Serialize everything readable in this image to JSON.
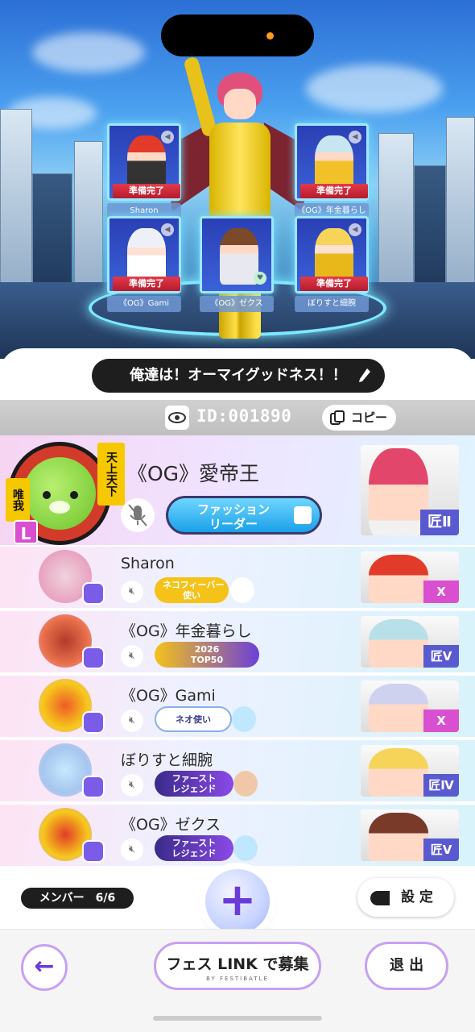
{
  "scene": {
    "party": [
      {
        "name": "Sharon",
        "status": "準備完了"
      },
      {
        "name": "《OG》年金暮らし",
        "status": "準備完了"
      },
      {
        "name": "《OG》Gami",
        "status": "準備完了"
      },
      {
        "name": "《OG》ゼクス",
        "status": ""
      },
      {
        "name": "ぼりすと細腕",
        "status": "準備完了"
      }
    ]
  },
  "team": {
    "name": "俺達は！オーマイグッドネス！！"
  },
  "room": {
    "id": "ID:001890",
    "copy_label": "コピー"
  },
  "leader": {
    "name": "《OG》愛帝王",
    "tag_right": "天上天下",
    "tag_left": "唯我",
    "leader_mark": "L",
    "title_line1": "ファッション",
    "title_line2": "リーダー",
    "rank": "匠Ⅱ"
  },
  "members": [
    {
      "name": "Sharon",
      "title1": "ネコフィーバー",
      "title2": "使い",
      "title_color": "#f5c21a",
      "rank": "X"
    },
    {
      "name": "《OG》年金暮らし",
      "title1": "2026",
      "title2": "TOP50",
      "title_color": "#6c3fd8",
      "rank": "匠Ⅴ"
    },
    {
      "name": "《OG》Gami",
      "title1": "ネオ使い",
      "title2": "",
      "title_color": "#ffffff",
      "rank": "X"
    },
    {
      "name": "ぼりすと細腕",
      "title1": "ファースト",
      "title2": "レジェンド",
      "title_color": "#6c3fd8",
      "rank": "匠Ⅳ"
    },
    {
      "name": "《OG》ゼクス",
      "title1": "ファースト",
      "title2": "レジェンド",
      "title_color": "#6c3fd8",
      "rank": "匠Ⅴ"
    }
  ],
  "footer": {
    "members_label": "メンバー　6/6",
    "plus_label": "+",
    "settings_label": "設 定",
    "back_label": "←",
    "recruit_label": "フェス LINK で募集",
    "recruit_sub": "BY FESTIBATLE",
    "exit_label": "退 出"
  },
  "colors": {
    "accent": "#6b3ad8",
    "ready_red": "#d42a3a",
    "badge_blue": "#1aa0e8"
  }
}
